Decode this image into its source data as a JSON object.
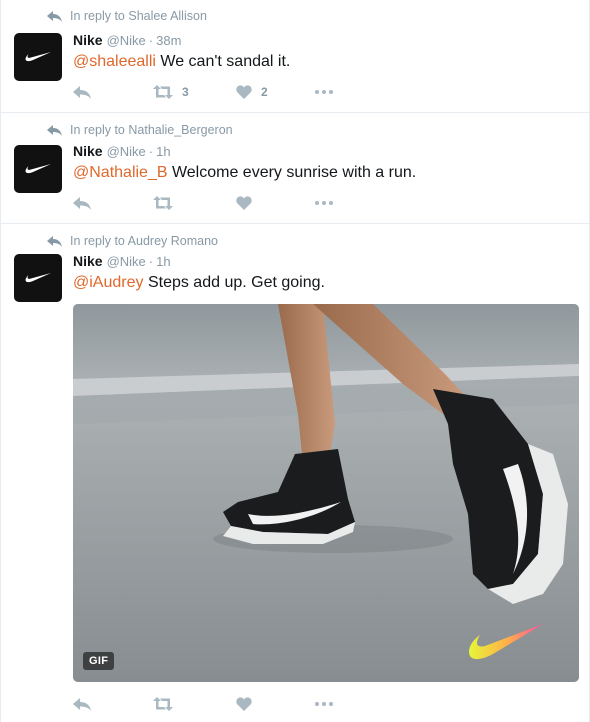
{
  "colors": {
    "accent_mention": "#e0682c",
    "muted": "#8899a6",
    "text": "#14171a",
    "divider": "#e6ecf0",
    "avatar_bg": "#111111"
  },
  "tweets": [
    {
      "reply_context": "In reply to Shalee Allison",
      "name": "Nike",
      "handle": "@Nike",
      "separator": "·",
      "time": "38m",
      "mention": "@shaleealli",
      "text": " We can't sandal it.",
      "retweets": "3",
      "likes": "2"
    },
    {
      "reply_context": "In reply to Nathalie_Bergeron",
      "name": "Nike",
      "handle": "@Nike",
      "separator": "·",
      "time": "1h",
      "mention": "@Nathalie_B",
      "text": " Welcome every sunrise with a run.",
      "retweets": "",
      "likes": ""
    },
    {
      "reply_context": "In reply to Audrey Romano",
      "name": "Nike",
      "handle": "@Nike",
      "separator": "·",
      "time": "1h",
      "mention": "@iAudrey",
      "text": " Steps add up. Get going.",
      "retweets": "",
      "likes": "",
      "media_badge": "GIF"
    }
  ],
  "icons": {
    "reply_context": "reply-arrow-icon",
    "reply": "reply-icon",
    "retweet": "retweet-icon",
    "like": "heart-icon",
    "more": "more-dots-icon",
    "avatar": "nike-swoosh-logo"
  }
}
